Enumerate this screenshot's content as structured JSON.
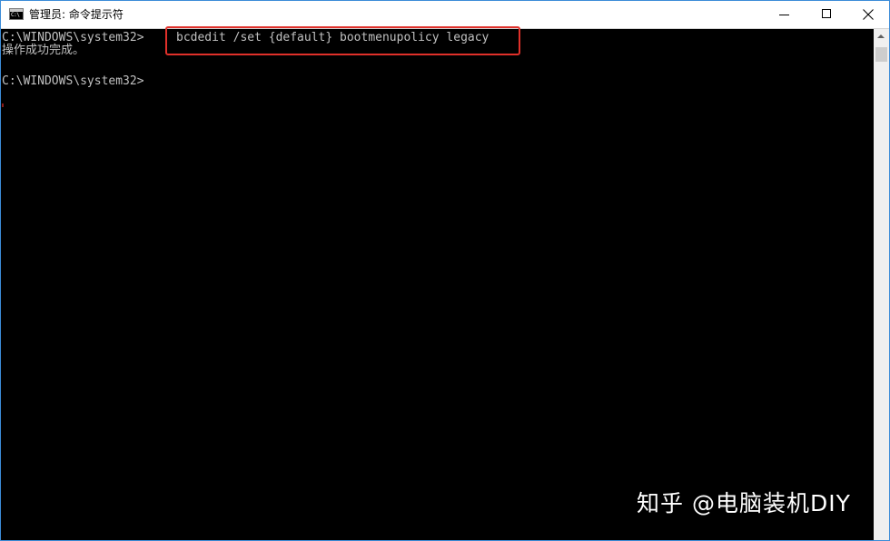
{
  "window": {
    "title": "管理员: 命令提示符",
    "icon_name": "cmd-icon",
    "icon_text": "C:\\"
  },
  "controls": {
    "minimize_icon": "minimize-icon",
    "maximize_icon": "maximize-icon",
    "close_icon": "close-icon"
  },
  "console": {
    "background": "#000000",
    "text_color": "#c0c0c0",
    "prompt1": "C:\\WINDOWS\\system32>",
    "command": "bcdedit /set {default} bootmenupolicy legacy",
    "output": "操作成功完成。",
    "prompt2": "C:\\WINDOWS\\system32>"
  },
  "annotation": {
    "color": "#e0302a"
  },
  "watermark": {
    "text": "知乎 @电脑装机DIY"
  }
}
